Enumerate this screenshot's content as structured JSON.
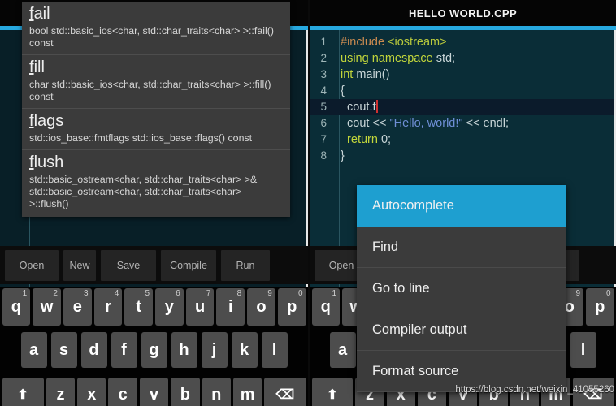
{
  "app": {
    "title": "HELLO WORLD.CPP",
    "accent_color": "#27a9e0",
    "editor_bg": "#0a2d37"
  },
  "code": {
    "lines": [
      {
        "num": "1",
        "tokens": [
          {
            "t": "#include ",
            "c": "tok-pre"
          },
          {
            "t": "<iostream>",
            "c": "tok-inc"
          }
        ]
      },
      {
        "num": "2",
        "tokens": [
          {
            "t": "using namespace ",
            "c": "tok-kw"
          },
          {
            "t": "std;",
            "c": "tok-id"
          }
        ]
      },
      {
        "num": "3",
        "tokens": [
          {
            "t": "int ",
            "c": "tok-kw"
          },
          {
            "t": "main()",
            "c": "tok-id"
          }
        ]
      },
      {
        "num": "4",
        "tokens": [
          {
            "t": "{",
            "c": "tok-pun"
          }
        ]
      },
      {
        "num": "5",
        "current": true,
        "caret": true,
        "tokens": [
          {
            "t": "  cout.f",
            "c": "tok-id"
          }
        ]
      },
      {
        "num": "6",
        "tokens": [
          {
            "t": "  cout << ",
            "c": "tok-id"
          },
          {
            "t": "\"Hello, world!\"",
            "c": "tok-str"
          },
          {
            "t": " << endl;",
            "c": "tok-id"
          }
        ]
      },
      {
        "num": "7",
        "tokens": [
          {
            "t": "  return ",
            "c": "tok-kw"
          },
          {
            "t": "0;",
            "c": "tok-num"
          }
        ]
      },
      {
        "num": "8",
        "tokens": [
          {
            "t": "}",
            "c": "tok-pun"
          }
        ]
      }
    ]
  },
  "autocomplete": {
    "items": [
      {
        "prefix": "f",
        "rest": "ail",
        "signature": "bool std::basic_ios<char, std::char_traits<char> >::fail() const"
      },
      {
        "prefix": "f",
        "rest": "ill",
        "signature": "char std::basic_ios<char, std::char_traits<char> >::fill() const"
      },
      {
        "prefix": "f",
        "rest": "lags",
        "signature": "std::ios_base::fmtflags std::ios_base::flags() const"
      },
      {
        "prefix": "f",
        "rest": "lush",
        "signature": "std::basic_ostream<char, std::char_traits<char> >& std::basic_ostream<char, std::char_traits<char> >::flush()"
      }
    ]
  },
  "context_menu": {
    "selected_index": 0,
    "items": [
      {
        "label": "Autocomplete"
      },
      {
        "label": "Find"
      },
      {
        "label": "Go to line"
      },
      {
        "label": "Compiler output"
      },
      {
        "label": "Format source"
      }
    ]
  },
  "toolbar": {
    "buttons": [
      {
        "label": "Open",
        "cls": "w-open"
      },
      {
        "label": "New",
        "cls": "w-new"
      },
      {
        "label": "Save",
        "cls": "w-save"
      },
      {
        "label": "Compile",
        "cls": "w-compile"
      },
      {
        "label": "Run",
        "cls": "w-run"
      }
    ]
  },
  "keyboard": {
    "row1": [
      {
        "key": "q",
        "num": "1"
      },
      {
        "key": "w",
        "num": "2"
      },
      {
        "key": "e",
        "num": "3"
      },
      {
        "key": "r",
        "num": "4"
      },
      {
        "key": "t",
        "num": "5"
      },
      {
        "key": "y",
        "num": "6"
      },
      {
        "key": "u",
        "num": "7"
      },
      {
        "key": "i",
        "num": "8"
      },
      {
        "key": "o",
        "num": "9"
      },
      {
        "key": "p",
        "num": "0"
      }
    ],
    "row2": [
      {
        "key": "a"
      },
      {
        "key": "s"
      },
      {
        "key": "d"
      },
      {
        "key": "f"
      },
      {
        "key": "g"
      },
      {
        "key": "h"
      },
      {
        "key": "j"
      },
      {
        "key": "k"
      },
      {
        "key": "l"
      }
    ],
    "row3": [
      {
        "key": "⬆",
        "role": "shift",
        "name": "shift-key"
      },
      {
        "key": "z"
      },
      {
        "key": "x"
      },
      {
        "key": "c"
      },
      {
        "key": "v"
      },
      {
        "key": "b"
      },
      {
        "key": "n"
      },
      {
        "key": "m"
      },
      {
        "key": "⌫",
        "role": "back",
        "name": "backspace-key"
      }
    ]
  },
  "watermark": {
    "text": "https://blog.csdn.net/weixin_41055260"
  }
}
